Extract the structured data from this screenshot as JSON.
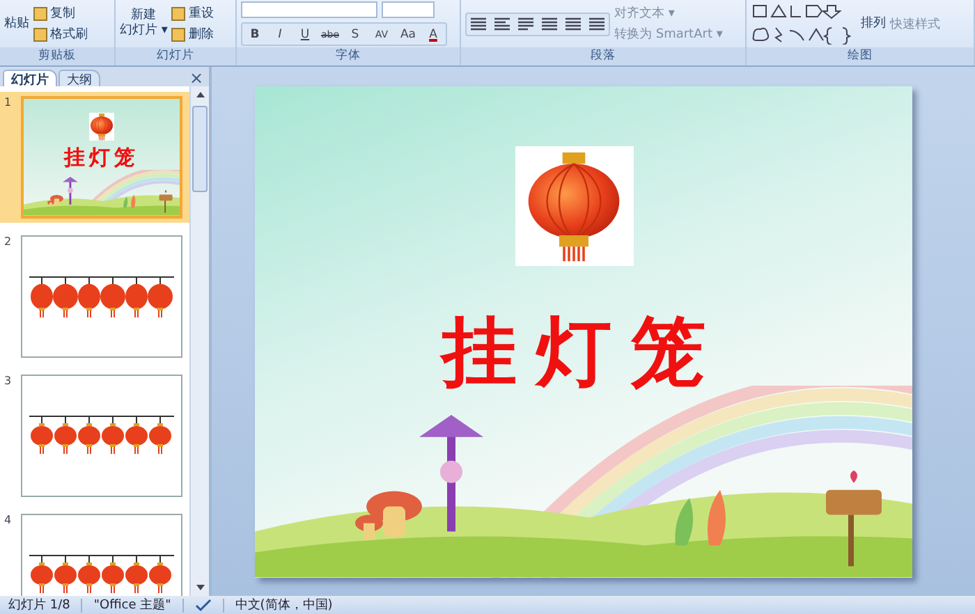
{
  "ribbon": {
    "groups": [
      {
        "label": "剪贴板",
        "kind": "clipboard",
        "big": {
          "label": "粘贴"
        },
        "small": [
          "复制",
          "格式刷"
        ]
      },
      {
        "label": "幻灯片",
        "kind": "slides",
        "big": {
          "lines": [
            "新建",
            "幻灯片 ▾"
          ]
        },
        "small": [
          "重设",
          "删除"
        ]
      },
      {
        "label": "字体",
        "kind": "font",
        "tools": [
          "B",
          "I",
          "U",
          "abe",
          "S",
          "AV",
          "Aa",
          "A"
        ]
      },
      {
        "label": "段落",
        "kind": "paragraph",
        "small": [
          "对齐文本 ▾",
          "转换为 SmartArt ▾"
        ]
      },
      {
        "label": "绘图",
        "kind": "drawing",
        "big": {
          "label": "排列"
        },
        "extra": "快速样式"
      }
    ]
  },
  "slides_pane": {
    "tabs": [
      {
        "label": "幻灯片",
        "selected": true
      },
      {
        "label": "大纲",
        "selected": false
      }
    ],
    "close": "×",
    "thumbnails": [
      {
        "number": "1",
        "selected": true,
        "kind": "title",
        "title": "挂灯笼"
      },
      {
        "number": "2",
        "selected": false,
        "kind": "lanterns"
      },
      {
        "number": "3",
        "selected": false,
        "kind": "lanterns"
      },
      {
        "number": "4",
        "selected": false,
        "kind": "lanterns"
      }
    ]
  },
  "slide": {
    "title": "挂灯笼"
  },
  "status_bar": {
    "slide": "幻灯片 1/8",
    "theme": "\"Office 主题\"",
    "language": "中文(简体，中国)"
  }
}
